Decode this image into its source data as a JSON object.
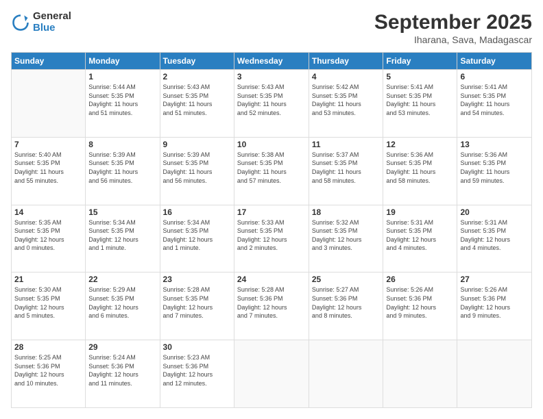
{
  "logo": {
    "general": "General",
    "blue": "Blue"
  },
  "header": {
    "title": "September 2025",
    "subtitle": "Iharana, Sava, Madagascar"
  },
  "weekdays": [
    "Sunday",
    "Monday",
    "Tuesday",
    "Wednesday",
    "Thursday",
    "Friday",
    "Saturday"
  ],
  "weeks": [
    [
      {
        "day": "",
        "info": ""
      },
      {
        "day": "1",
        "info": "Sunrise: 5:44 AM\nSunset: 5:35 PM\nDaylight: 11 hours\nand 51 minutes."
      },
      {
        "day": "2",
        "info": "Sunrise: 5:43 AM\nSunset: 5:35 PM\nDaylight: 11 hours\nand 51 minutes."
      },
      {
        "day": "3",
        "info": "Sunrise: 5:43 AM\nSunset: 5:35 PM\nDaylight: 11 hours\nand 52 minutes."
      },
      {
        "day": "4",
        "info": "Sunrise: 5:42 AM\nSunset: 5:35 PM\nDaylight: 11 hours\nand 53 minutes."
      },
      {
        "day": "5",
        "info": "Sunrise: 5:41 AM\nSunset: 5:35 PM\nDaylight: 11 hours\nand 53 minutes."
      },
      {
        "day": "6",
        "info": "Sunrise: 5:41 AM\nSunset: 5:35 PM\nDaylight: 11 hours\nand 54 minutes."
      }
    ],
    [
      {
        "day": "7",
        "info": "Sunrise: 5:40 AM\nSunset: 5:35 PM\nDaylight: 11 hours\nand 55 minutes."
      },
      {
        "day": "8",
        "info": "Sunrise: 5:39 AM\nSunset: 5:35 PM\nDaylight: 11 hours\nand 56 minutes."
      },
      {
        "day": "9",
        "info": "Sunrise: 5:39 AM\nSunset: 5:35 PM\nDaylight: 11 hours\nand 56 minutes."
      },
      {
        "day": "10",
        "info": "Sunrise: 5:38 AM\nSunset: 5:35 PM\nDaylight: 11 hours\nand 57 minutes."
      },
      {
        "day": "11",
        "info": "Sunrise: 5:37 AM\nSunset: 5:35 PM\nDaylight: 11 hours\nand 58 minutes."
      },
      {
        "day": "12",
        "info": "Sunrise: 5:36 AM\nSunset: 5:35 PM\nDaylight: 11 hours\nand 58 minutes."
      },
      {
        "day": "13",
        "info": "Sunrise: 5:36 AM\nSunset: 5:35 PM\nDaylight: 11 hours\nand 59 minutes."
      }
    ],
    [
      {
        "day": "14",
        "info": "Sunrise: 5:35 AM\nSunset: 5:35 PM\nDaylight: 12 hours\nand 0 minutes."
      },
      {
        "day": "15",
        "info": "Sunrise: 5:34 AM\nSunset: 5:35 PM\nDaylight: 12 hours\nand 1 minute."
      },
      {
        "day": "16",
        "info": "Sunrise: 5:34 AM\nSunset: 5:35 PM\nDaylight: 12 hours\nand 1 minute."
      },
      {
        "day": "17",
        "info": "Sunrise: 5:33 AM\nSunset: 5:35 PM\nDaylight: 12 hours\nand 2 minutes."
      },
      {
        "day": "18",
        "info": "Sunrise: 5:32 AM\nSunset: 5:35 PM\nDaylight: 12 hours\nand 3 minutes."
      },
      {
        "day": "19",
        "info": "Sunrise: 5:31 AM\nSunset: 5:35 PM\nDaylight: 12 hours\nand 4 minutes."
      },
      {
        "day": "20",
        "info": "Sunrise: 5:31 AM\nSunset: 5:35 PM\nDaylight: 12 hours\nand 4 minutes."
      }
    ],
    [
      {
        "day": "21",
        "info": "Sunrise: 5:30 AM\nSunset: 5:35 PM\nDaylight: 12 hours\nand 5 minutes."
      },
      {
        "day": "22",
        "info": "Sunrise: 5:29 AM\nSunset: 5:35 PM\nDaylight: 12 hours\nand 6 minutes."
      },
      {
        "day": "23",
        "info": "Sunrise: 5:28 AM\nSunset: 5:35 PM\nDaylight: 12 hours\nand 7 minutes."
      },
      {
        "day": "24",
        "info": "Sunrise: 5:28 AM\nSunset: 5:36 PM\nDaylight: 12 hours\nand 7 minutes."
      },
      {
        "day": "25",
        "info": "Sunrise: 5:27 AM\nSunset: 5:36 PM\nDaylight: 12 hours\nand 8 minutes."
      },
      {
        "day": "26",
        "info": "Sunrise: 5:26 AM\nSunset: 5:36 PM\nDaylight: 12 hours\nand 9 minutes."
      },
      {
        "day": "27",
        "info": "Sunrise: 5:26 AM\nSunset: 5:36 PM\nDaylight: 12 hours\nand 9 minutes."
      }
    ],
    [
      {
        "day": "28",
        "info": "Sunrise: 5:25 AM\nSunset: 5:36 PM\nDaylight: 12 hours\nand 10 minutes."
      },
      {
        "day": "29",
        "info": "Sunrise: 5:24 AM\nSunset: 5:36 PM\nDaylight: 12 hours\nand 11 minutes."
      },
      {
        "day": "30",
        "info": "Sunrise: 5:23 AM\nSunset: 5:36 PM\nDaylight: 12 hours\nand 12 minutes."
      },
      {
        "day": "",
        "info": ""
      },
      {
        "day": "",
        "info": ""
      },
      {
        "day": "",
        "info": ""
      },
      {
        "day": "",
        "info": ""
      }
    ]
  ]
}
